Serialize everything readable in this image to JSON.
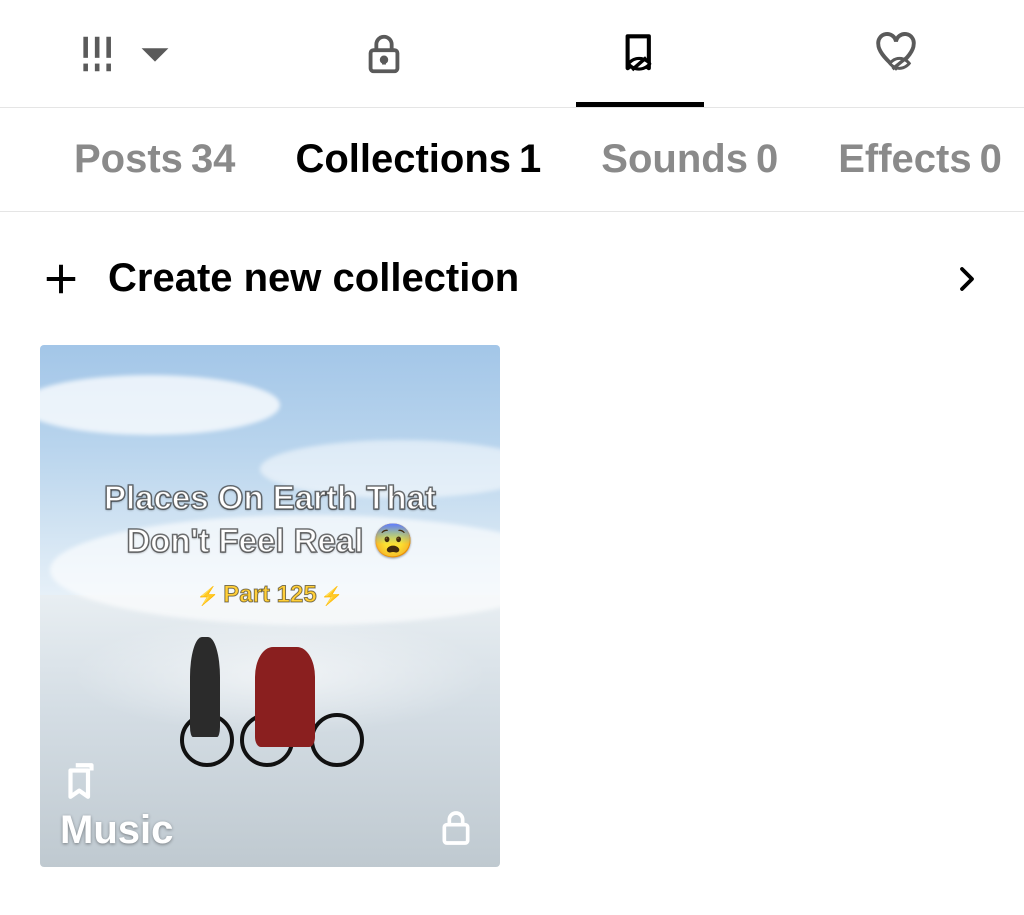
{
  "iconTabs": {
    "active": "saved"
  },
  "subTabs": {
    "items": [
      {
        "label": "Posts",
        "count": "34",
        "active": false
      },
      {
        "label": "Collections",
        "count": "1",
        "active": true
      },
      {
        "label": "Sounds",
        "count": "0",
        "active": false
      },
      {
        "label": "Effects",
        "count": "0",
        "active": false
      }
    ]
  },
  "createRow": {
    "label": "Create new collection"
  },
  "collections": [
    {
      "name": "Music",
      "private": true,
      "thumbText": "Places On Earth That Don't Feel Real 😨",
      "thumbSub": "Part 125"
    }
  ]
}
